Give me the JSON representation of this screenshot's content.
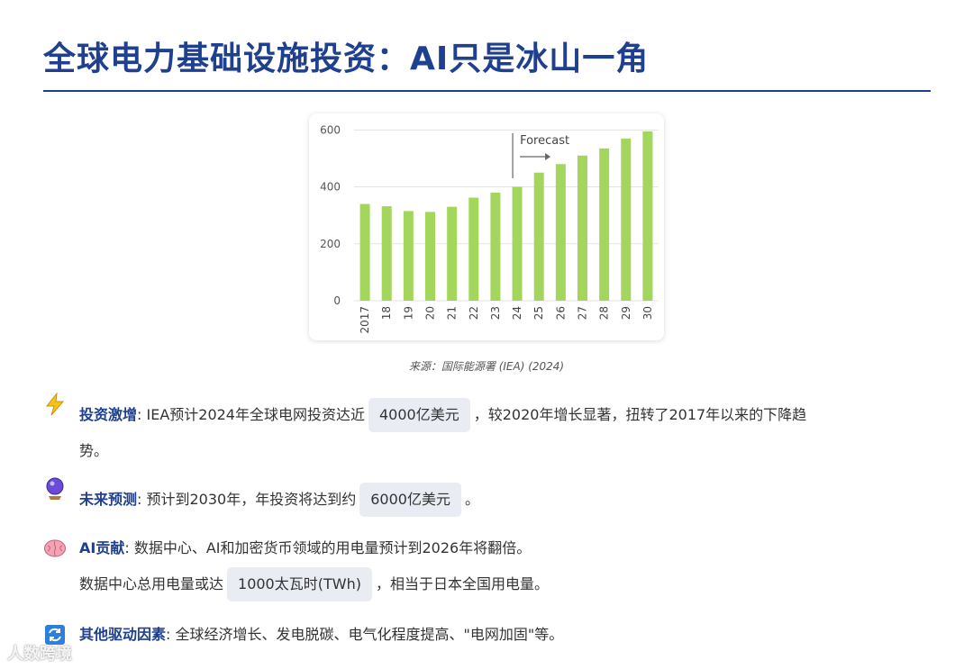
{
  "header": {
    "title": "全球电力基础设施投资：AI只是冰山一角"
  },
  "chart_data": {
    "type": "bar",
    "categories": [
      "2017",
      "18",
      "19",
      "20",
      "21",
      "22",
      "23",
      "24",
      "25",
      "26",
      "27",
      "28",
      "29",
      "30"
    ],
    "values": [
      340,
      332,
      315,
      312,
      330,
      362,
      380,
      400,
      450,
      480,
      510,
      535,
      570,
      595
    ],
    "yticks": [
      "0",
      "200",
      "400",
      "600"
    ],
    "ylim": [
      0,
      620
    ],
    "grid": true,
    "annotation": "Forecast",
    "forecast_start_category": "24",
    "color": "#a4d65e"
  },
  "source": "来源：国际能源署 (IEA) (2024)",
  "items": [
    {
      "icon": "lightning-icon",
      "label": "投资激增",
      "text_before": ": IEA预计2024年全球电网投资达近",
      "highlight": "4000亿美元",
      "text_after": "，较2020年增长显著，扭转了2017年以来的下降趋",
      "text_cont": "势。"
    },
    {
      "icon": "crystal-ball-icon",
      "label": "未来预测",
      "text_before": ": 预计到2030年，年投资将达到约",
      "highlight": "6000亿美元",
      "text_after": "。"
    },
    {
      "icon": "brain-icon",
      "label": "AI贡献",
      "text_before": ": 数据中心、AI和加密货币领域的用电量预计到2026年将翻倍。",
      "line2_before": "数据中心总用电量或达",
      "highlight": "1000太瓦时(TWh)",
      "line2_after": "，相当于日本全国用电量。"
    },
    {
      "icon": "refresh-icon",
      "label": "其他驱动因素",
      "text_before": ": 全球经济增长、发电脱碳、电气化程度提高、\"电网加固\"等。"
    }
  ],
  "watermark": "人数跨境"
}
